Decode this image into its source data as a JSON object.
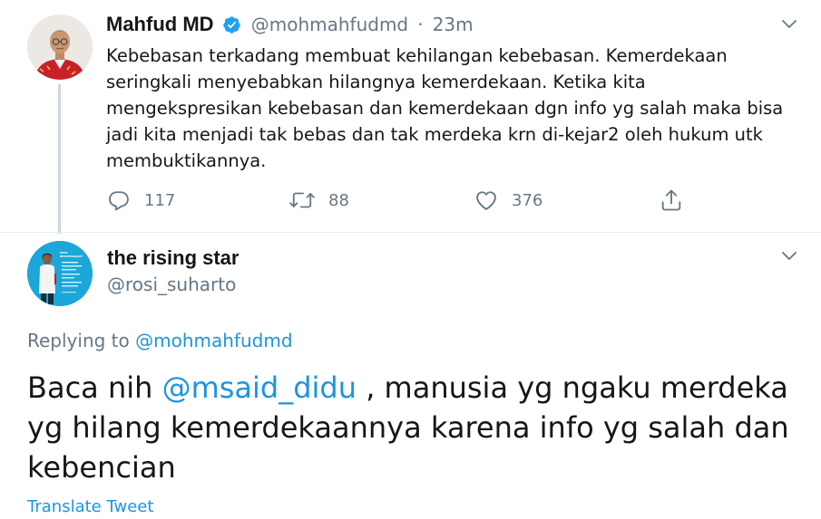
{
  "tweet1": {
    "display_name": "Mahfud MD",
    "handle": "@mohmahfudmd",
    "separator": "·",
    "time": "23m",
    "text": "Kebebasan terkadang membuat kehilangan kebebasan. Kemerdekaan\nseringkali menyebabkan hilangnya kemerdekaan. Ketika kita\nmengekspresikan kebebasan dan kemerdekaan dgn info yg salah maka bisa\njadi kita menjadi tak bebas dan tak merdeka krn di-kejar2 oleh hukum utk\nmembuktikannya.",
    "reply_count": "117",
    "retweet_count": "88",
    "like_count": "376"
  },
  "tweet2": {
    "display_name": "the rising star",
    "handle": "@rosi_suharto",
    "replying_prefix": "Replying to",
    "replying_to": "@mohmahfudmd",
    "text_before": "Baca nih ",
    "mention": "@msaid_didu",
    "text_after": " , manusia yg ngaku merdeka yg hilang kemerdekaannya karena info yg salah dan kebencian",
    "translate_label": "Translate Tweet",
    "avatar_lettering": "MARI BERSEMANGAT"
  },
  "icons": {
    "reply": "reply-icon",
    "retweet": "retweet-icon",
    "like": "heart-icon",
    "share": "share-icon",
    "verified": "verified-badge-icon",
    "more": "chevron-down-icon"
  },
  "colors": {
    "text": "#14171a",
    "secondary": "#657786",
    "link": "#1b95e0",
    "verified": "#1da1f2",
    "thread_line": "#ccd6dd"
  }
}
